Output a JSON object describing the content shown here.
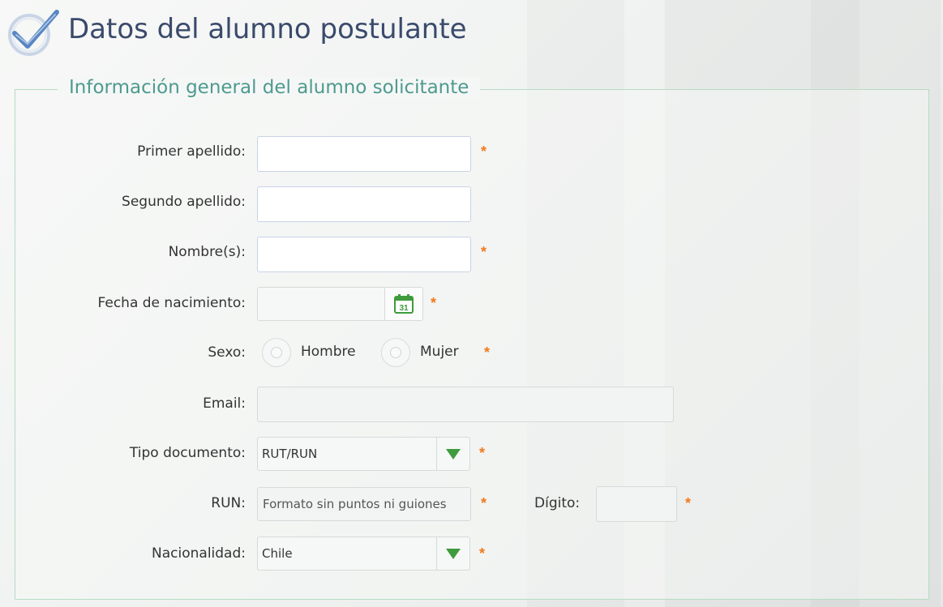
{
  "header": {
    "title": "Datos del alumno postulante",
    "icon": "check-circle-icon"
  },
  "section": {
    "title": "Información general del alumno solicitante"
  },
  "form": {
    "primer_apellido": {
      "label": "Primer apellido:",
      "value": "",
      "required": "*"
    },
    "segundo_apellido": {
      "label": "Segundo apellido:",
      "value": ""
    },
    "nombres": {
      "label": "Nombre(s):",
      "value": "",
      "required": "*"
    },
    "fecha_nacimiento": {
      "label": "Fecha de nacimiento:",
      "value": "",
      "required": "*",
      "icon": "calendar-icon",
      "calendar_day": "31"
    },
    "sexo": {
      "label": "Sexo:",
      "options": [
        "Hombre",
        "Mujer"
      ],
      "required": "*"
    },
    "email": {
      "label": "Email:",
      "value": ""
    },
    "tipo_documento": {
      "label": "Tipo documento:",
      "value": "RUT/RUN",
      "required": "*"
    },
    "run": {
      "label": "RUN:",
      "placeholder": "Formato sin puntos ni guiones",
      "required": "*"
    },
    "digito": {
      "label": "Dígito:",
      "value": "",
      "required": "*"
    },
    "nacionalidad": {
      "label": "Nacionalidad:",
      "value": "Chile",
      "required": "*"
    }
  },
  "colors": {
    "title": "#3a4a6b",
    "section_title": "#4e9a8f",
    "required": "#f07a1e",
    "arrow": "#3f9b3c",
    "border": "#b6dcc4"
  }
}
